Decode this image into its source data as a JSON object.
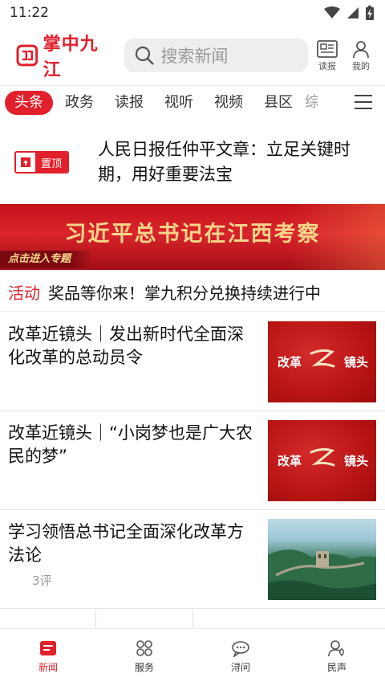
{
  "status_bar": {
    "time": "11:22"
  },
  "header": {
    "app_name": "掌中九江",
    "search_placeholder": "搜索新闻",
    "read_paper_label": "读报",
    "mine_label": "我的"
  },
  "tabs": [
    {
      "label": "头条",
      "active": true
    },
    {
      "label": "政务"
    },
    {
      "label": "读报"
    },
    {
      "label": "视听"
    },
    {
      "label": "视频"
    },
    {
      "label": "县区"
    },
    {
      "label": "综"
    }
  ],
  "pinned": {
    "badge": "置顶",
    "title": "人民日报任仲平文章：立足关键时期，用好重要法宝"
  },
  "banner": {
    "title": "习近平总书记在江西考察",
    "subtitle": "点击进入专题"
  },
  "activity": {
    "tag": "活动",
    "text": "奖品等你来！掌九积分兑换持续进行中"
  },
  "news": [
    {
      "title": "改革近镜头｜发出新时代全面深化改革的总动员令",
      "thumb_left": "改革",
      "thumb_right": "镜头"
    },
    {
      "title": "改革近镜头｜“小岗梦也是广大农民的梦”",
      "thumb_left": "改革",
      "thumb_right": "镜头"
    },
    {
      "title": "学习领悟总书记全面深化改革方法论",
      "comments": "3评"
    }
  ],
  "bottom_nav": [
    {
      "label": "新闻",
      "active": true
    },
    {
      "label": "服务"
    },
    {
      "label": "浔问"
    },
    {
      "label": "民声"
    }
  ],
  "colors": {
    "accent": "#e1202b",
    "banner_text": "#f7d58a"
  }
}
